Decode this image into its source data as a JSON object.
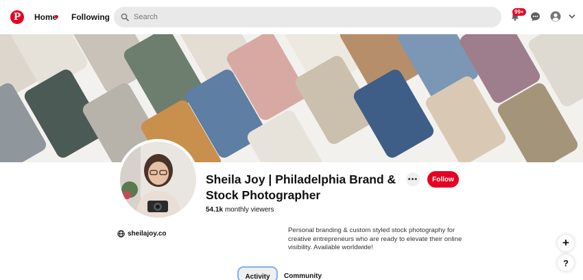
{
  "header": {
    "logo_icon": "pinterest-logo-icon",
    "logo_glyph": "P",
    "nav_home": "Home",
    "nav_following": "Following",
    "search_placeholder": "Search",
    "notification_badge": "99+",
    "brand_color": "#e60023"
  },
  "profile": {
    "name": "Sheila Joy | Philadelphia Brand & Stock Photographer",
    "viewers_count": "54.1k",
    "viewers_label": "monthly viewers",
    "follow_label": "Follow",
    "more_label": "•••",
    "website": "sheilajoy.co",
    "bio": "Personal branding & custom styled stock photography for creative entrepreneurs who are ready to elevate their online visibility. Available worldwide!"
  },
  "tabs": {
    "activity": "Activity",
    "community": "Community"
  },
  "fab": {
    "plus": "+",
    "help": "?"
  }
}
